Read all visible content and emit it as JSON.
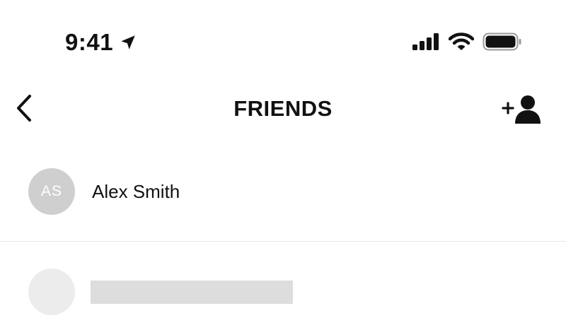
{
  "status_bar": {
    "time": "9:41",
    "icons": [
      "location-arrow-icon",
      "cellular-signal-icon",
      "wifi-icon",
      "battery-icon"
    ]
  },
  "nav": {
    "title": "FRIENDS",
    "back_icon": "chevron-left-icon",
    "add_icon": "add-person-icon"
  },
  "friends": [
    {
      "initials": "AS",
      "name": "Alex Smith"
    }
  ],
  "colors": {
    "text": "#111111",
    "avatar_bg": "#cfcfcf",
    "placeholder_avatar": "#ececec",
    "placeholder_bar": "#dddddd",
    "divider": "#e6e6e6"
  }
}
